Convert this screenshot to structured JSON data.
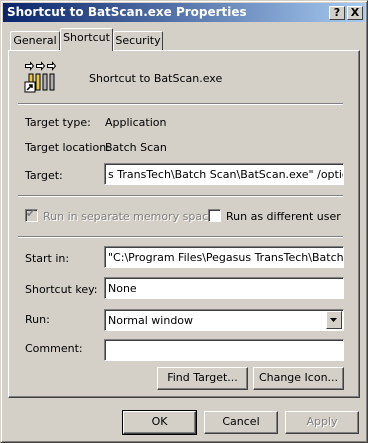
{
  "window": {
    "title": "Shortcut to BatScan.exe Properties",
    "help_label": "?",
    "close_label": "X"
  },
  "tabs": [
    {
      "label": "General"
    },
    {
      "label": "Shortcut"
    },
    {
      "label": "Security"
    }
  ],
  "header": {
    "name": "Shortcut to BatScan.exe"
  },
  "info": {
    "target_type_label": "Target type:",
    "target_type_value": "Application",
    "target_location_label": "Target location:",
    "target_location_value": "Batch Scan",
    "target_label": "Target:",
    "target_value": "s TransTech\\Batch Scan\\BatScan.exe\" /options"
  },
  "options": {
    "run_separate_memory": "Run in separate memory space",
    "run_as_different_user": "Run as different user"
  },
  "fields": {
    "start_in_label": "Start in:",
    "start_in_value": "\"C:\\Program Files\\Pegasus TransTech\\Batch Sc",
    "shortcut_key_label": "Shortcut key:",
    "shortcut_key_value": "None",
    "run_label": "Run:",
    "run_value": "Normal window",
    "comment_label": "Comment:",
    "comment_value": ""
  },
  "buttons": {
    "find_target": "Find Target...",
    "change_icon": "Change Icon...",
    "ok": "OK",
    "cancel": "Cancel",
    "apply": "Apply"
  }
}
